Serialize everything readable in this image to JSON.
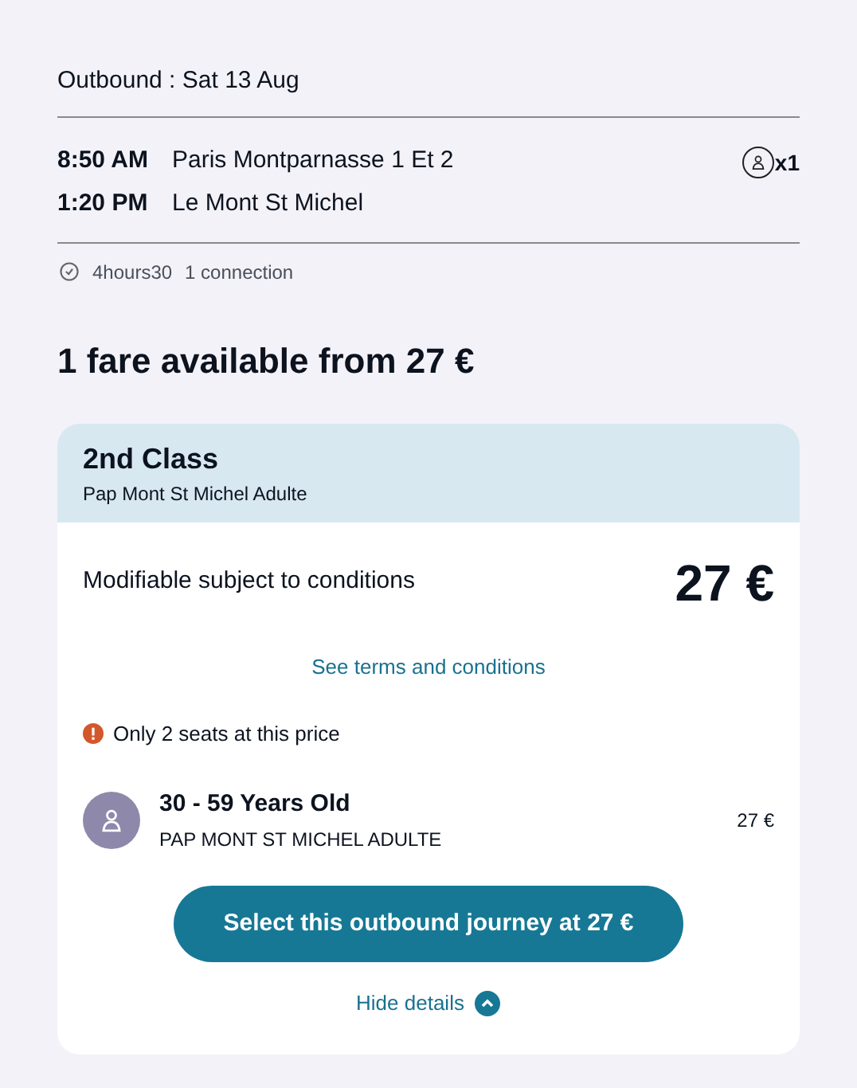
{
  "heading": "Outbound : Sat 13 Aug",
  "stops": [
    {
      "time": "8:50 AM",
      "station": "Paris Montparnasse 1 Et 2"
    },
    {
      "time": "1:20 PM",
      "station": "Le Mont St Michel"
    }
  ],
  "passengers": "x1",
  "duration": "4hours30",
  "connections": "1 connection",
  "fares_title": "1 fare available from 27 €",
  "fare": {
    "class": "2nd Class",
    "name": "Pap Mont St Michel Adulte",
    "conditions": "Modifiable subject to conditions",
    "price": "27 €",
    "terms_link": "See terms and conditions",
    "warning": "Only 2 seats at this price",
    "travellers": [
      {
        "age": "30 - 59 Years Old",
        "tariff": "PAP MONT ST MICHEL ADULTE",
        "price": "27 €"
      }
    ],
    "select_button": "Select this outbound journey at 27 €",
    "toggle": "Hide details",
    "expanded": true
  }
}
